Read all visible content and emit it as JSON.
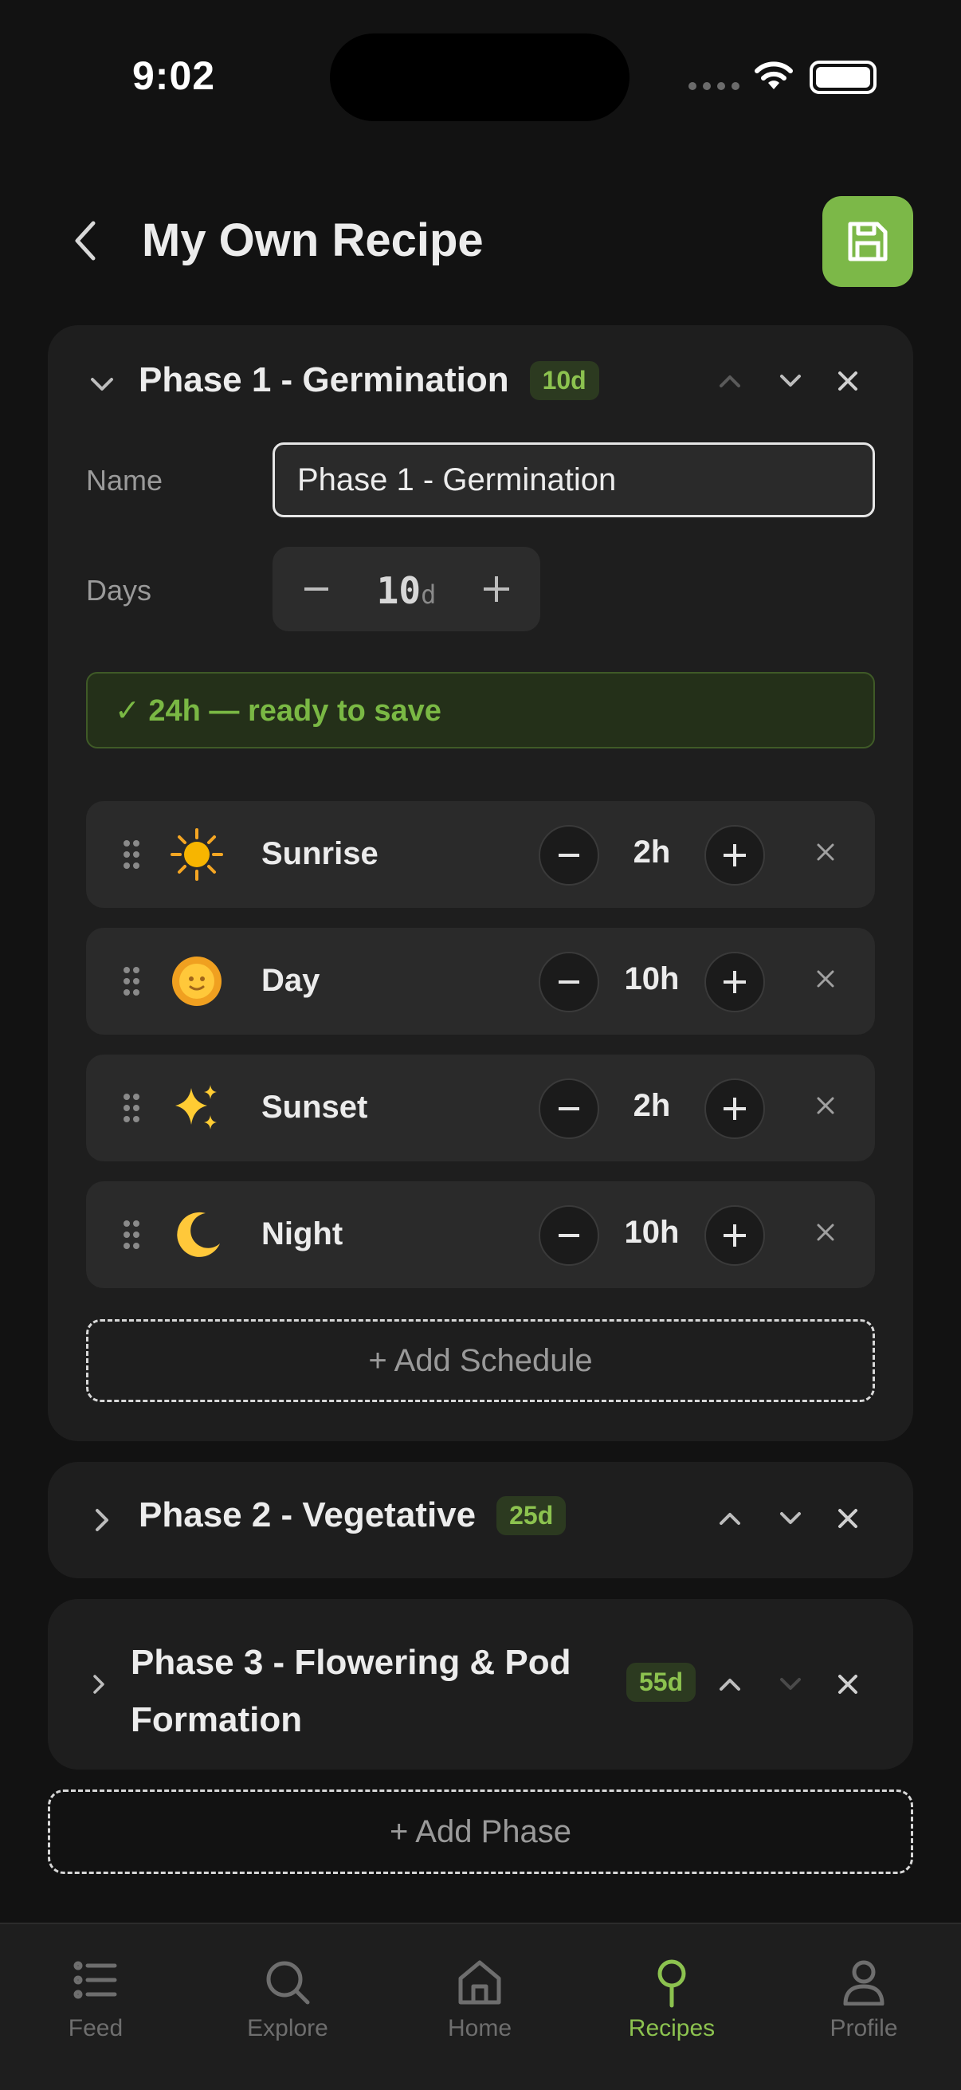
{
  "status_bar": {
    "time": "9:02"
  },
  "header": {
    "title": "My Own Recipe",
    "back_icon": "chevron-left-icon",
    "save_icon": "floppy-disk-icon"
  },
  "colors": {
    "accent": "#7cb848",
    "accent_text": "#8cc24f",
    "background": "#121212",
    "card": "#1e1e1e"
  },
  "phase1": {
    "title": "Phase 1 - Germination",
    "days_badge": "10d",
    "name_label": "Name",
    "name_value": "Phase 1 - Germination",
    "days_label": "Days",
    "days_value": "10",
    "days_unit": "d",
    "stepper_minus": "−",
    "stepper_plus": "+",
    "banner": "✓ 24h — ready to save",
    "schedules": [
      {
        "emoji": "☀️",
        "name": "Sunrise",
        "hours": "2h"
      },
      {
        "emoji": "🌞",
        "name": "Day",
        "hours": "10h"
      },
      {
        "emoji": "✨",
        "name": "Sunset",
        "hours": "2h"
      },
      {
        "emoji": "🌙",
        "name": "Night",
        "hours": "10h"
      }
    ],
    "add_schedule": "+ Add Schedule"
  },
  "phase2": {
    "title": "Phase 2 - Vegetative",
    "days_badge": "25d"
  },
  "phase3": {
    "title_line1": "Phase 3 - Flowering & Pod",
    "title_line2": "Formation",
    "days_badge": "55d"
  },
  "add_phase": "+ Add Phase",
  "tabs": [
    {
      "label": "Feed",
      "icon": "list-icon",
      "active": false
    },
    {
      "label": "Explore",
      "icon": "search-icon",
      "active": false
    },
    {
      "label": "Home",
      "icon": "home-icon",
      "active": false
    },
    {
      "label": "Recipes",
      "icon": "map-pin-icon",
      "active": true
    },
    {
      "label": "Profile",
      "icon": "user-icon",
      "active": false
    }
  ]
}
